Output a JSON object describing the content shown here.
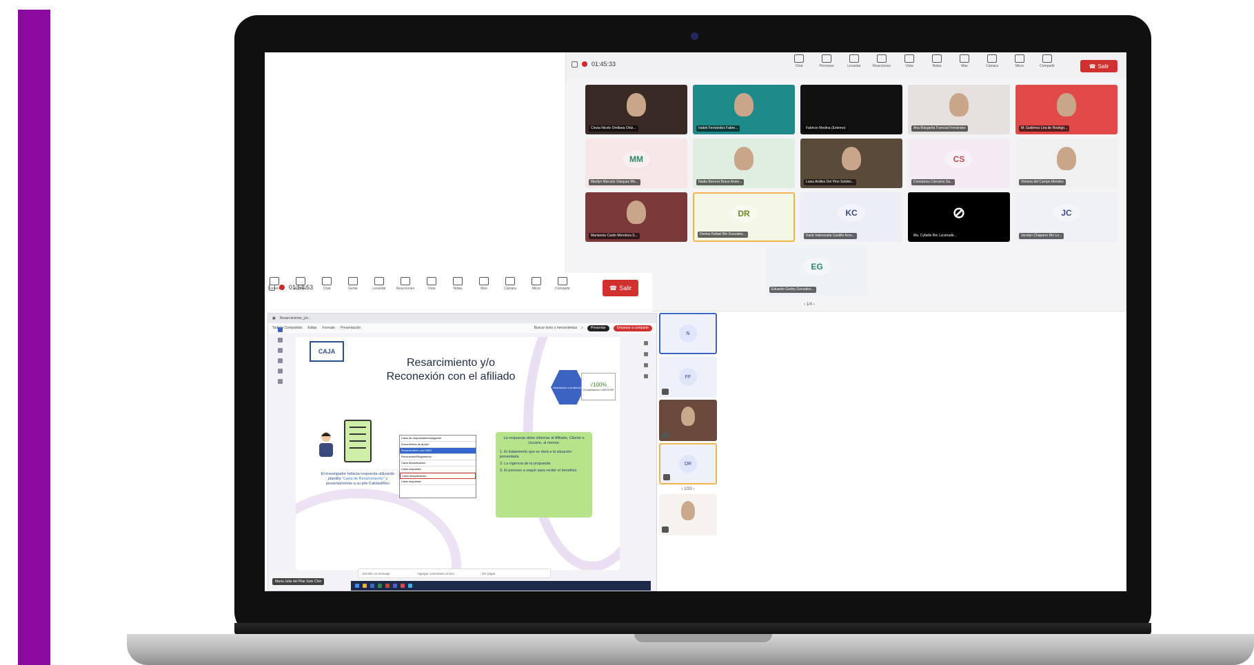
{
  "colors": {
    "accent_bar": "#8a0aa0",
    "leave": "#d0302e",
    "brand_blue": "#3b63c2"
  },
  "meeting_top": {
    "time": "01:45:33",
    "toolbar": [
      {
        "icon": "chat-icon",
        "label": "Chat"
      },
      {
        "icon": "people-icon",
        "label": "Personas"
      },
      {
        "icon": "raise-hand-icon",
        "label": "Levantar"
      },
      {
        "icon": "reactions-icon",
        "label": "Reacciones"
      },
      {
        "icon": "view-icon",
        "label": "Vista"
      },
      {
        "icon": "notes-icon",
        "label": "Notas"
      },
      {
        "icon": "more-icon",
        "label": "Más"
      },
      {
        "icon": "camera-icon",
        "label": "Cámara"
      },
      {
        "icon": "mic-icon",
        "label": "Micro"
      },
      {
        "icon": "share-icon",
        "label": "Compartir"
      }
    ],
    "leave_label": "Salir",
    "participants": [
      {
        "name": "Cinzia Nicole Orellana Ortiz...",
        "initials": "",
        "bg": "#3a2a25",
        "photo": true
      },
      {
        "name": "Isabel Fernández Fabre...",
        "initials": "",
        "bg": "#1f8a8a",
        "photo": true
      },
      {
        "name": "Fabricio Medina (Externo)",
        "initials": "",
        "bg": "#111111",
        "photo": false
      },
      {
        "name": "Ana Margarita Fuenzal Fernández",
        "initials": "",
        "bg": "#e6e1dd",
        "photo": true
      },
      {
        "name": "M. Gutiérrez Lira de Rodrigo...",
        "initials": "",
        "bg": "#e24a4a",
        "photo": true
      },
      {
        "name": "Marilyn Marcela Vásquez Mo...",
        "initials": "MM",
        "bg": "#f7e6e6",
        "color": "#2a8a6a",
        "photo": false
      },
      {
        "name": "Nadia Barrera Bravo Ansie...",
        "initials": "",
        "bg": "#e0eee0",
        "photo": true
      },
      {
        "name": "Luisa Ardiles Del Pino Soldán...",
        "initials": "",
        "bg": "#5a4a3a",
        "photo": true
      },
      {
        "name": "Constanza Cárcamo Sa...",
        "initials": "CS",
        "bg": "#f4eaf4",
        "color": "#c0485a",
        "photo": false
      },
      {
        "name": "Ximena del Campo Mendes",
        "initials": "",
        "bg": "#f0f0f0",
        "photo": true
      },
      {
        "name": "Marianela Cardo Mendoza S...",
        "initials": "",
        "bg": "#7a3a3a",
        "photo": true
      },
      {
        "name": "Denise Rafael Rin Gonzalez...",
        "initials": "DR",
        "bg": "#f4f6e6",
        "color": "#6a8a2a",
        "photo": false,
        "active": true
      },
      {
        "name": "Karla Valenzuela Castillo Arce...",
        "initials": "KC",
        "bg": "#eceef6",
        "color": "#3a4a8a",
        "photo": false
      },
      {
        "name": "Ma. Cybelle Rin Lucenade...",
        "initials": "",
        "bg": "#000000",
        "photo": false,
        "camera_off": true
      },
      {
        "name": "Jocelyn Chaparro Rin Lo...",
        "initials": "JC",
        "bg": "#eef0f6",
        "color": "#3a4a8a",
        "photo": false
      },
      {
        "name": "Eduardo Godoy Gonzalez...",
        "initials": "EG",
        "bg": "#eef2f6",
        "color": "#2a8a6a",
        "photo": false
      }
    ],
    "pager": "1/4"
  },
  "meeting_share": {
    "time": "01:54:53",
    "toolbar": [
      {
        "icon": "fullscreen-icon",
        "label": "Contenir"
      },
      {
        "icon": "refresh-icon",
        "label": "Agregar"
      },
      {
        "icon": "chat-icon",
        "label": "Chat"
      },
      {
        "icon": "people-icon",
        "label": "Gente"
      },
      {
        "icon": "raise-hand-icon",
        "label": "Levantar"
      },
      {
        "icon": "reactions-icon",
        "label": "Reacciones"
      },
      {
        "icon": "view-icon",
        "label": "Vista"
      },
      {
        "icon": "notes-icon",
        "label": "Notas"
      },
      {
        "icon": "more-icon",
        "label": "Más"
      },
      {
        "icon": "camera-icon",
        "label": "Cámara"
      },
      {
        "icon": "mic-icon",
        "label": "Micro"
      },
      {
        "icon": "share-icon",
        "label": "Compartir"
      }
    ],
    "leave_label": "Salir",
    "browser_tab": "Resarcimiento_y/o...",
    "menu": [
      "Todo lo Compartido",
      "Editar",
      "Formato",
      "Presentación"
    ],
    "menu_right": "Buscar texto o herramientas",
    "pill_present": "Presentar",
    "pill_record": "Empezar a compartir",
    "slide": {
      "logo": "CAJA",
      "title_line1": "Resarcimiento y/o",
      "title_line2": "Reconexión con el afiliado",
      "hex_text": "Orientación a la Atención",
      "badge_big": "√100%",
      "badge_small": "Cumplimiento CARTA RP",
      "desc_pre": "El investigador redacta respuesta utilizando plantilla ",
      "desc_hl": "\"Carta de Resarcimiento\"",
      "desc_post": " y presenta/remite a su jefe Calidad/Rev",
      "dropdown": [
        "Carta de respuesta/investigación",
        "Documentos de apoyo",
        "Resarcimiento con IMED",
        "Reconexión/Reglamento",
        "Carta desactivación",
        "Carta respuesta",
        "Carta desactivación",
        "Carta respuesta"
      ],
      "callout_intro": "La respuesta debe informar al Afiliado, Cliente o Usuario, al menos:",
      "callout_items": [
        "1. El tratamiento que se dará a la situación presentada",
        "2. La vigencia de la propuesta",
        "3. El proceso a seguir para recibir el beneficio"
      ]
    },
    "chat_placeholder": "Escribir un mensaje",
    "chat_action": "Agregar comentario al vivo",
    "chat_action2": "Ver pagar",
    "presenter_name": "María Julia del Pilar Soto Chin",
    "strip": [
      {
        "initials": "N",
        "selected": true
      },
      {
        "initials": "FF",
        "selected": false
      },
      {
        "initials": "",
        "photo": true
      },
      {
        "initials": "DR",
        "active": true
      },
      {
        "initials": "",
        "photo": true,
        "light": true
      }
    ],
    "strip_pager": "1/20"
  }
}
